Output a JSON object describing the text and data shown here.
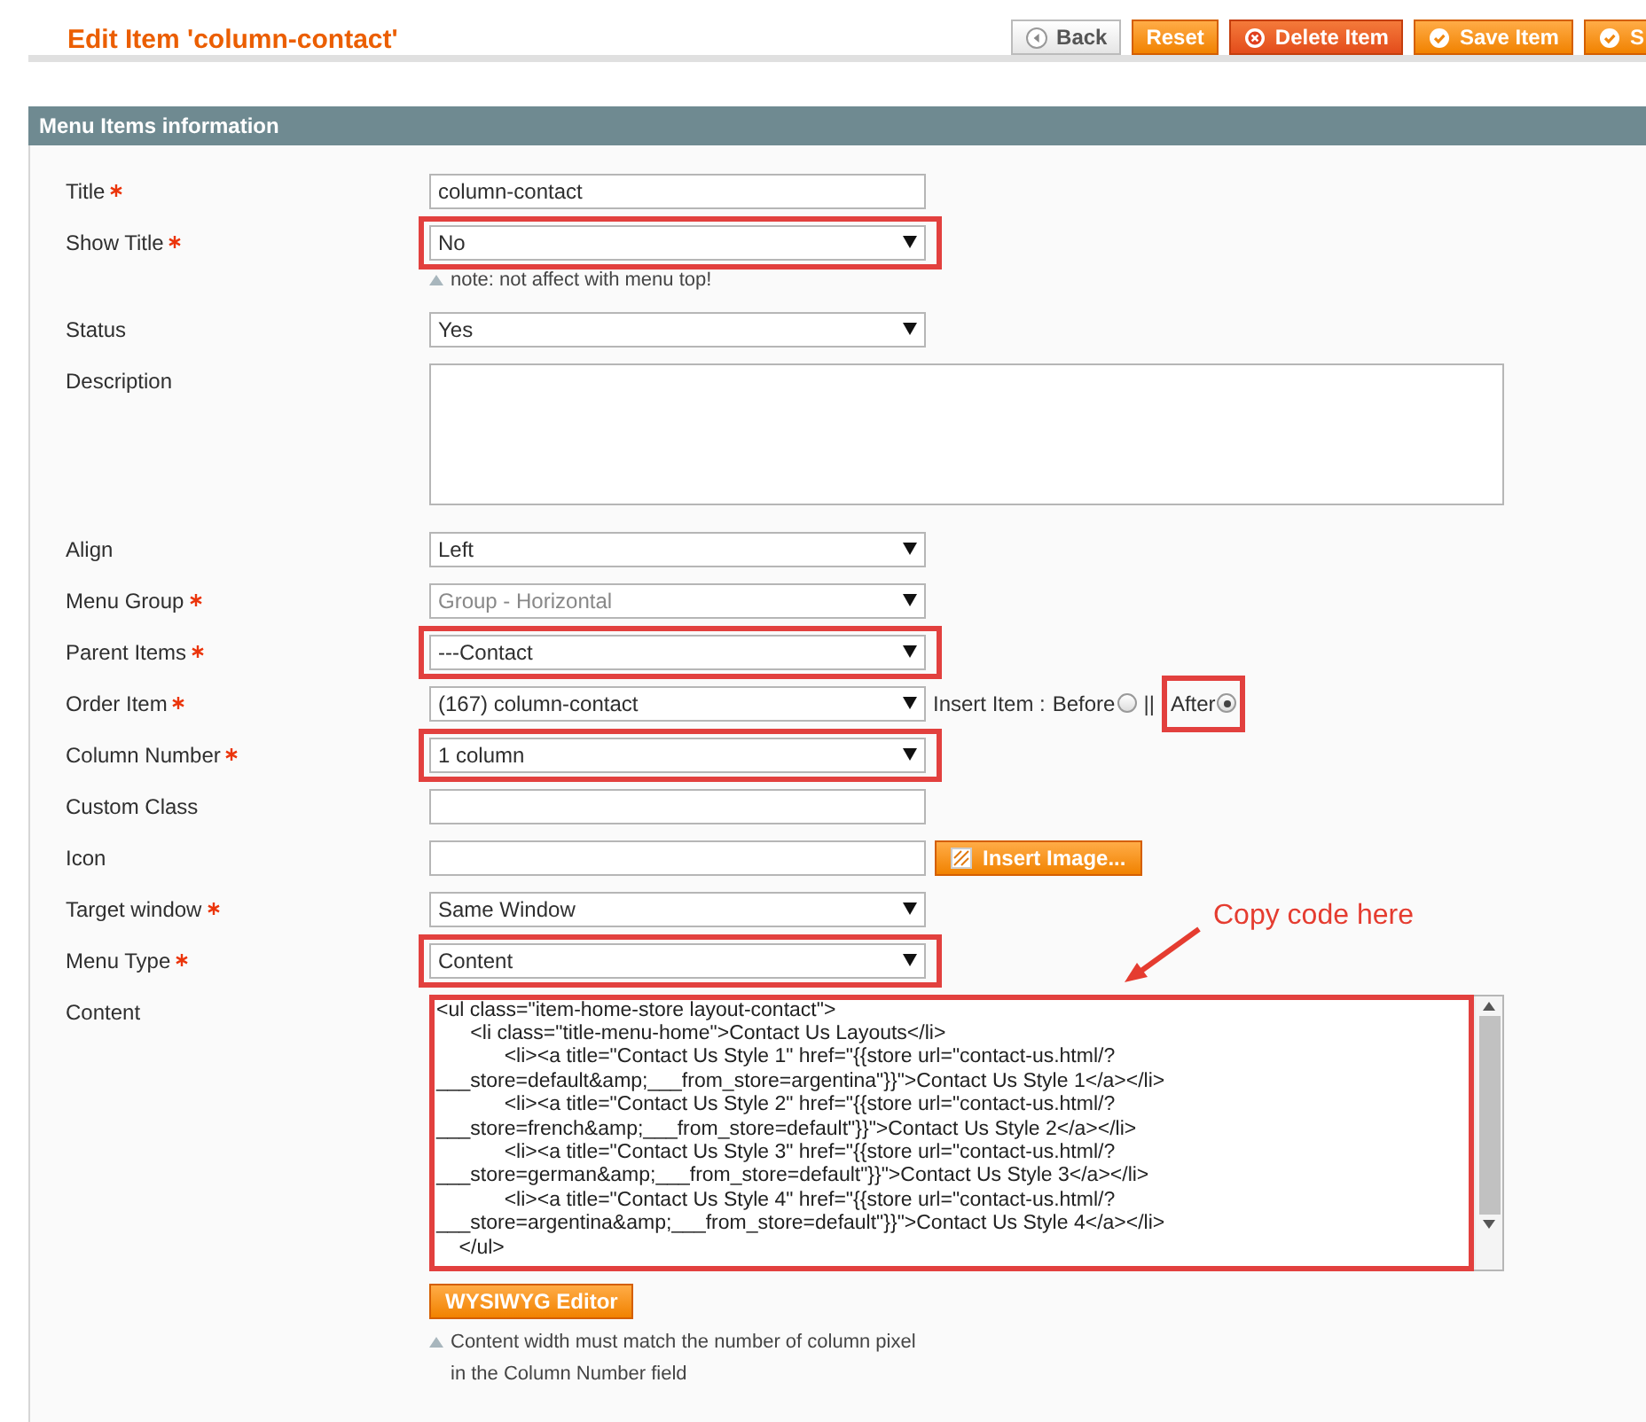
{
  "header": {
    "title": "Edit Item 'column-contact'",
    "buttons": [
      {
        "kind": "back",
        "label": "Back"
      },
      {
        "kind": "plain",
        "label": "Reset"
      },
      {
        "kind": "delete",
        "label": "Delete Item"
      },
      {
        "kind": "save",
        "label": "Save Item"
      },
      {
        "kind": "save",
        "label": "S"
      }
    ]
  },
  "panel": {
    "title": "Menu Items information",
    "fields": [
      {
        "kind": "text",
        "label": "Title",
        "required": true,
        "value": "column-contact",
        "highlighted": false
      },
      {
        "kind": "select",
        "label": "Show Title",
        "required": true,
        "value": "No",
        "disabled": false,
        "highlighted": true,
        "note": "note: not affect with menu top!"
      },
      {
        "kind": "select",
        "label": "Status",
        "required": false,
        "value": "Yes",
        "disabled": false,
        "highlighted": false
      },
      {
        "kind": "textarea",
        "label": "Description",
        "required": false,
        "highlighted": false
      },
      {
        "kind": "select",
        "label": "Align",
        "required": false,
        "value": "Left",
        "disabled": false,
        "highlighted": false
      },
      {
        "kind": "select",
        "label": "Menu Group",
        "required": true,
        "value": "Group - Horizontal",
        "disabled": true,
        "highlighted": false
      },
      {
        "kind": "select",
        "label": "Parent Items",
        "required": true,
        "value": "---Contact",
        "disabled": false,
        "highlighted": true
      },
      {
        "kind": "order",
        "label": "Order Item",
        "required": true,
        "value": "(167) column-contact",
        "disabled": false,
        "highlighted": false,
        "insert_label": "Insert Item :",
        "separator": "||",
        "positions": [
          {
            "label": "Before",
            "selected": false,
            "highlighted": false
          },
          {
            "label": "After",
            "selected": true,
            "highlighted": true
          }
        ]
      },
      {
        "kind": "select",
        "label": "Column Number",
        "required": true,
        "value": "1 column",
        "disabled": false,
        "highlighted": true
      },
      {
        "kind": "text",
        "label": "Custom Class",
        "required": false,
        "highlighted": false
      },
      {
        "kind": "image",
        "label": "Icon",
        "required": false,
        "highlighted": false,
        "button": "Insert Image..."
      },
      {
        "kind": "select",
        "label": "Target window",
        "required": true,
        "value": "Same Window",
        "disabled": false,
        "highlighted": false
      },
      {
        "kind": "select",
        "label": "Menu Type",
        "required": true,
        "value": "Content",
        "disabled": false,
        "highlighted": true
      },
      {
        "kind": "code",
        "label": "Content",
        "required": false,
        "highlighted": true,
        "value": "<ul class=\"item-home-store layout-contact\">\n\t<li class=\"title-menu-home\">Contact Us Layouts</li>\n\t\t<li><a title=\"Contact Us Style 1\" href=\"{{store url=\"contact-us.html/?\n___store=default&amp;___from_store=argentina\"}}\">Contact Us Style 1</a></li>\n\t\t<li><a title=\"Contact Us Style 2\" href=\"{{store url=\"contact-us.html/?\n___store=french&amp;___from_store=default\"}}\">Contact Us Style 2</a></li>\n\t\t<li><a title=\"Contact Us Style 3\" href=\"{{store url=\"contact-us.html/?\n___store=german&amp;___from_store=default\"}}\">Contact Us Style 3</a></li>\n\t\t<li><a title=\"Contact Us Style 4\" href=\"{{store url=\"contact-us.html/?\n___store=argentina&amp;___from_store=default\"}}\">Contact Us Style 4</a></li>\n    </ul>",
        "button": "WYSIWYG Editor",
        "note": "Content width must match the number of column pixel\nin the Column Number field"
      }
    ],
    "annotation": {
      "text": "Copy code here"
    }
  }
}
